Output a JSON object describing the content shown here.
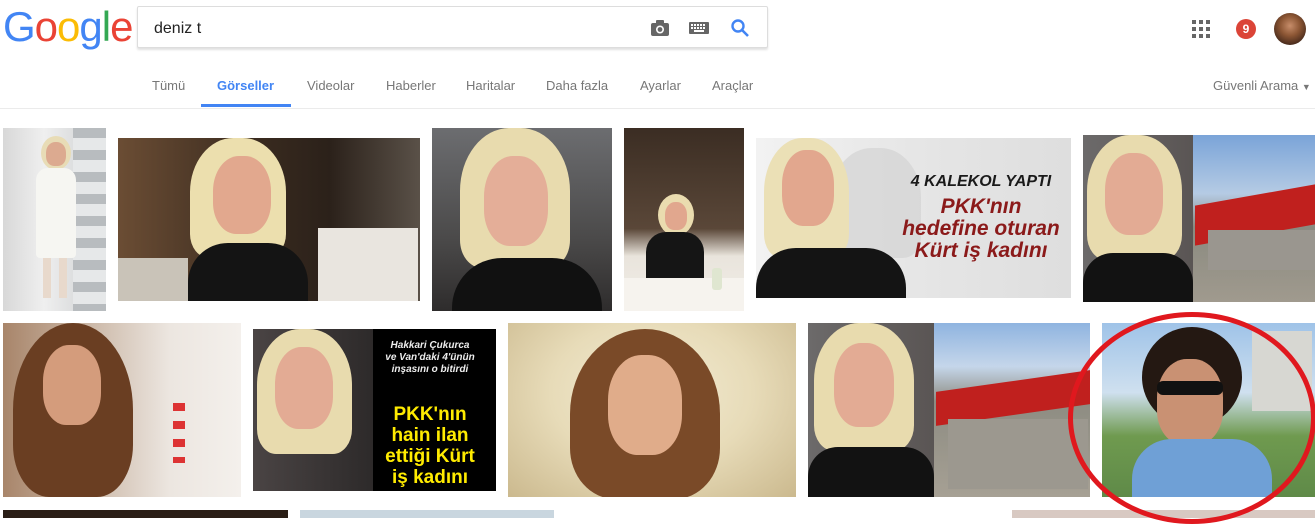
{
  "logo": {
    "letters": [
      "G",
      "o",
      "o",
      "g",
      "l",
      "e"
    ],
    "colors": [
      "#4285f4",
      "#ea4335",
      "#fbbc05",
      "#4285f4",
      "#34a853",
      "#ea4335"
    ]
  },
  "search": {
    "value": "deniz t"
  },
  "header": {
    "notification_count": "9"
  },
  "tabs": [
    {
      "label": "Tümü"
    },
    {
      "label": "Görseller"
    },
    {
      "label": "Videolar"
    },
    {
      "label": "Haberler"
    },
    {
      "label": "Haritalar"
    },
    {
      "label": "Daha fazla"
    },
    {
      "label": "Ayarlar"
    },
    {
      "label": "Araçlar"
    }
  ],
  "safe_search": {
    "label": "Güvenli Arama"
  },
  "images": {
    "img5": {
      "line1": "4 KALEKOL YAPTI",
      "line2": "PKK'nın",
      "line3": "hedefine oturan",
      "line4": "Kürt iş kadını"
    },
    "img8": {
      "line1": "Hakkari Çukurca",
      "line2": "ve Van'daki 4'ünün",
      "line3": "inşasını o bitirdi",
      "line4": "PKK'nın",
      "line5": "hain ilan",
      "line6": "ettiği Kürt",
      "line7": "iş kadını"
    }
  },
  "colors": {
    "accent": "#4285f4",
    "highlight_circle": "#e0181e",
    "headline_red": "#8b1a1a",
    "headline_yellow": "#ffeb00"
  }
}
